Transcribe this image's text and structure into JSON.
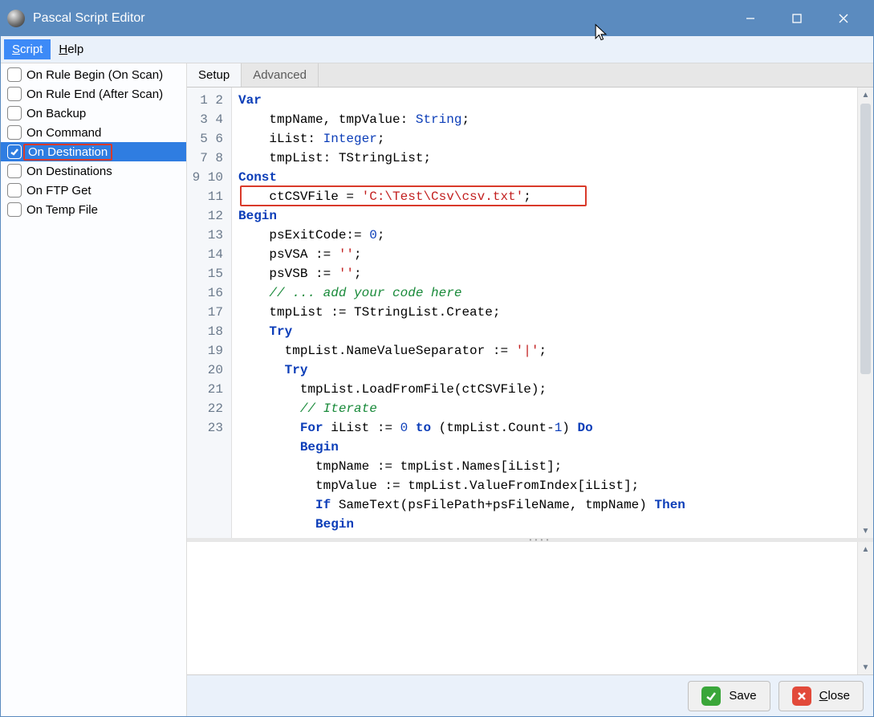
{
  "window": {
    "title": "Pascal Script Editor"
  },
  "menubar": {
    "items": [
      {
        "label": "Script",
        "underline_first": true,
        "selected": true
      },
      {
        "label": "Help",
        "underline_first": true,
        "selected": false
      }
    ]
  },
  "sidebar": {
    "items": [
      {
        "label": "On Rule Begin (On Scan)",
        "checked": false,
        "selected": false,
        "redbox": false
      },
      {
        "label": "On Rule End (After Scan)",
        "checked": false,
        "selected": false,
        "redbox": false
      },
      {
        "label": "On Backup",
        "checked": false,
        "selected": false,
        "redbox": false
      },
      {
        "label": "On Command",
        "checked": false,
        "selected": false,
        "redbox": false
      },
      {
        "label": "On Destination",
        "checked": true,
        "selected": true,
        "redbox": true
      },
      {
        "label": "On Destinations",
        "checked": false,
        "selected": false,
        "redbox": false
      },
      {
        "label": "On FTP Get",
        "checked": false,
        "selected": false,
        "redbox": false
      },
      {
        "label": "On Temp File",
        "checked": false,
        "selected": false,
        "redbox": false
      }
    ]
  },
  "tabs": {
    "items": [
      {
        "label": "Setup",
        "active": true
      },
      {
        "label": "Advanced",
        "active": false
      }
    ]
  },
  "code": {
    "line_count": 23,
    "highlight_line": 6,
    "tokens": [
      [
        {
          "t": "Var",
          "c": "kw"
        }
      ],
      [
        {
          "t": "    tmpName, tmpValue: ",
          "c": ""
        },
        {
          "t": "String",
          "c": "kwn"
        },
        {
          "t": ";",
          "c": ""
        }
      ],
      [
        {
          "t": "    iList: ",
          "c": ""
        },
        {
          "t": "Integer",
          "c": "kwn"
        },
        {
          "t": ";",
          "c": ""
        }
      ],
      [
        {
          "t": "    tmpList: TStringList;",
          "c": ""
        }
      ],
      [
        {
          "t": "Const",
          "c": "kw"
        }
      ],
      [
        {
          "t": "    ctCSVFile = ",
          "c": ""
        },
        {
          "t": "'C:\\Test\\Csv\\csv.txt'",
          "c": "str"
        },
        {
          "t": ";",
          "c": ""
        }
      ],
      [
        {
          "t": "Begin",
          "c": "kw"
        }
      ],
      [
        {
          "t": "    psExitCode:= ",
          "c": ""
        },
        {
          "t": "0",
          "c": "num"
        },
        {
          "t": ";",
          "c": ""
        }
      ],
      [
        {
          "t": "    psVSA := ",
          "c": ""
        },
        {
          "t": "''",
          "c": "str"
        },
        {
          "t": ";",
          "c": ""
        }
      ],
      [
        {
          "t": "    psVSB := ",
          "c": ""
        },
        {
          "t": "''",
          "c": "str"
        },
        {
          "t": ";",
          "c": ""
        }
      ],
      [
        {
          "t": "    ",
          "c": ""
        },
        {
          "t": "// ... add your code here",
          "c": "cm"
        }
      ],
      [
        {
          "t": "    tmpList := TStringList.Create;",
          "c": ""
        }
      ],
      [
        {
          "t": "    ",
          "c": ""
        },
        {
          "t": "Try",
          "c": "kw"
        }
      ],
      [
        {
          "t": "      tmpList.NameValueSeparator := ",
          "c": ""
        },
        {
          "t": "'|'",
          "c": "str"
        },
        {
          "t": ";",
          "c": ""
        }
      ],
      [
        {
          "t": "      ",
          "c": ""
        },
        {
          "t": "Try",
          "c": "kw"
        }
      ],
      [
        {
          "t": "        tmpList.LoadFromFile(ctCSVFile);",
          "c": ""
        }
      ],
      [
        {
          "t": "        ",
          "c": ""
        },
        {
          "t": "// Iterate",
          "c": "cm"
        }
      ],
      [
        {
          "t": "        ",
          "c": ""
        },
        {
          "t": "For",
          "c": "kw"
        },
        {
          "t": " iList := ",
          "c": ""
        },
        {
          "t": "0",
          "c": "num"
        },
        {
          "t": " ",
          "c": ""
        },
        {
          "t": "to",
          "c": "kw"
        },
        {
          "t": " (tmpList.Count-",
          "c": ""
        },
        {
          "t": "1",
          "c": "num"
        },
        {
          "t": ") ",
          "c": ""
        },
        {
          "t": "Do",
          "c": "kw"
        }
      ],
      [
        {
          "t": "        ",
          "c": ""
        },
        {
          "t": "Begin",
          "c": "kw"
        }
      ],
      [
        {
          "t": "          tmpName := tmpList.Names[iList];",
          "c": ""
        }
      ],
      [
        {
          "t": "          tmpValue := tmpList.ValueFromIndex[iList];",
          "c": ""
        }
      ],
      [
        {
          "t": "          ",
          "c": ""
        },
        {
          "t": "If",
          "c": "kw"
        },
        {
          "t": " SameText(psFilePath+psFileName, tmpName) ",
          "c": ""
        },
        {
          "t": "Then",
          "c": "kw"
        }
      ],
      [
        {
          "t": "          ",
          "c": ""
        },
        {
          "t": "Begin",
          "c": "kw"
        }
      ]
    ]
  },
  "footer": {
    "save_label": "Save",
    "close_label": "Close"
  }
}
